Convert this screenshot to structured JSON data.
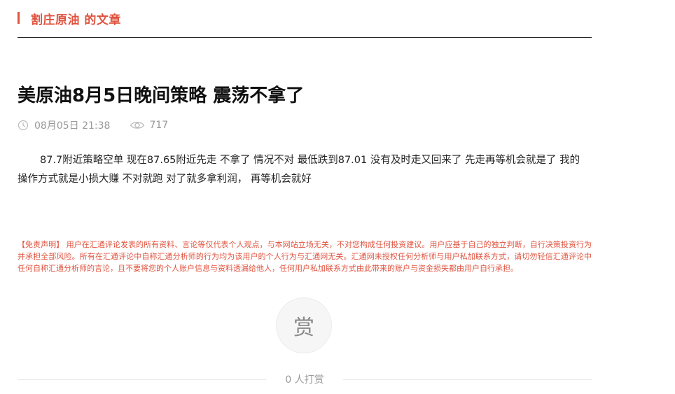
{
  "header": {
    "section_title": "割庄原油 的文章",
    "accent_color": "#e0533f"
  },
  "article": {
    "title": "美原油8月5日晚间策略 震荡不拿了",
    "date": "08月05日 21:38",
    "views": "717",
    "body": "87.7附近策略空单  现在87.65附近先走 不拿了  情况不对  最低跌到87.01 没有及时走又回来了 先走再等机会就是了   我的操作方式就是小损大赚 不对就跑 对了就多拿利润，  再等机会就好",
    "icons": {
      "time": "clock-icon",
      "views": "eye-icon"
    }
  },
  "disclaimer": {
    "text": "【免责声明】 用户在汇通评论发表的所有资料、言论等仅代表个人观点，与本网站立场无关，不对您构成任何投资建议。用户应基于自己的独立判断，自行决策投资行为并承担全部风险。所有在汇通评论中自称汇通分析师的行为均为该用户的个人行为与汇通网无关。汇通网未授权任何分析师与用户私加联系方式，请切勿轻信汇通评论中任何自称汇通分析师的言论，且不要将您的个人账户信息与资料透漏给他人，任何用户私加联系方式由此带来的账户与资金损失都由用户自行承担。",
    "color": "#e0533f"
  },
  "reward": {
    "button_label": "赏",
    "count_text": "0 人打赏"
  }
}
